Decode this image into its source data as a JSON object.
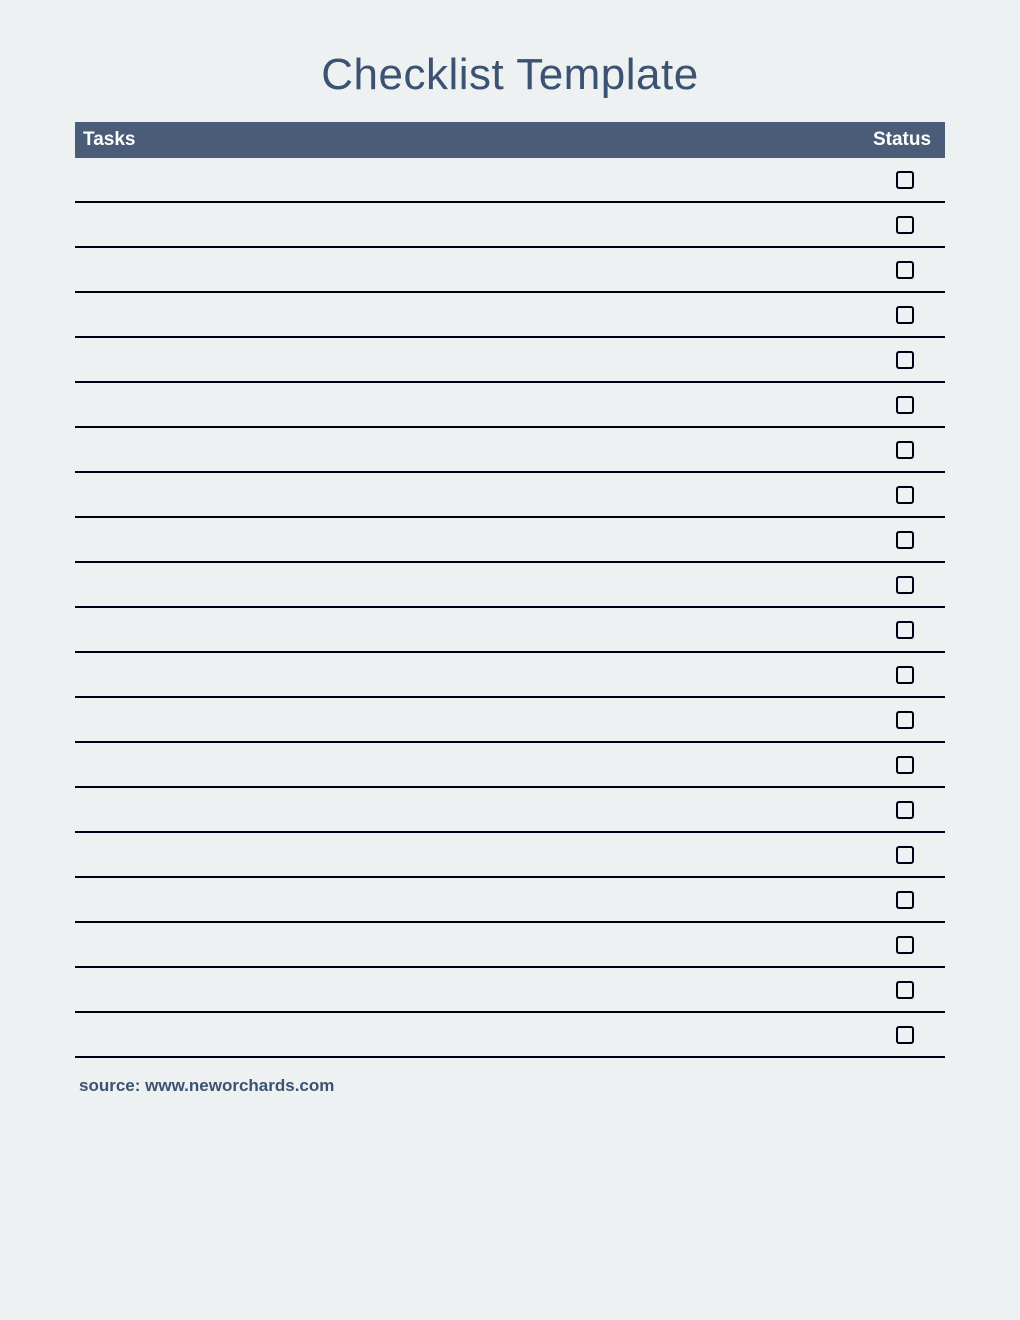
{
  "title": "Checklist Template",
  "headers": {
    "tasks": "Tasks",
    "status": "Status"
  },
  "rows": [
    {
      "task": "",
      "checked": false
    },
    {
      "task": "",
      "checked": false
    },
    {
      "task": "",
      "checked": false
    },
    {
      "task": "",
      "checked": false
    },
    {
      "task": "",
      "checked": false
    },
    {
      "task": "",
      "checked": false
    },
    {
      "task": "",
      "checked": false
    },
    {
      "task": "",
      "checked": false
    },
    {
      "task": "",
      "checked": false
    },
    {
      "task": "",
      "checked": false
    },
    {
      "task": "",
      "checked": false
    },
    {
      "task": "",
      "checked": false
    },
    {
      "task": "",
      "checked": false
    },
    {
      "task": "",
      "checked": false
    },
    {
      "task": "",
      "checked": false
    },
    {
      "task": "",
      "checked": false
    },
    {
      "task": "",
      "checked": false
    },
    {
      "task": "",
      "checked": false
    },
    {
      "task": "",
      "checked": false
    },
    {
      "task": "",
      "checked": false
    }
  ],
  "source": "source: www.neworchards.com"
}
